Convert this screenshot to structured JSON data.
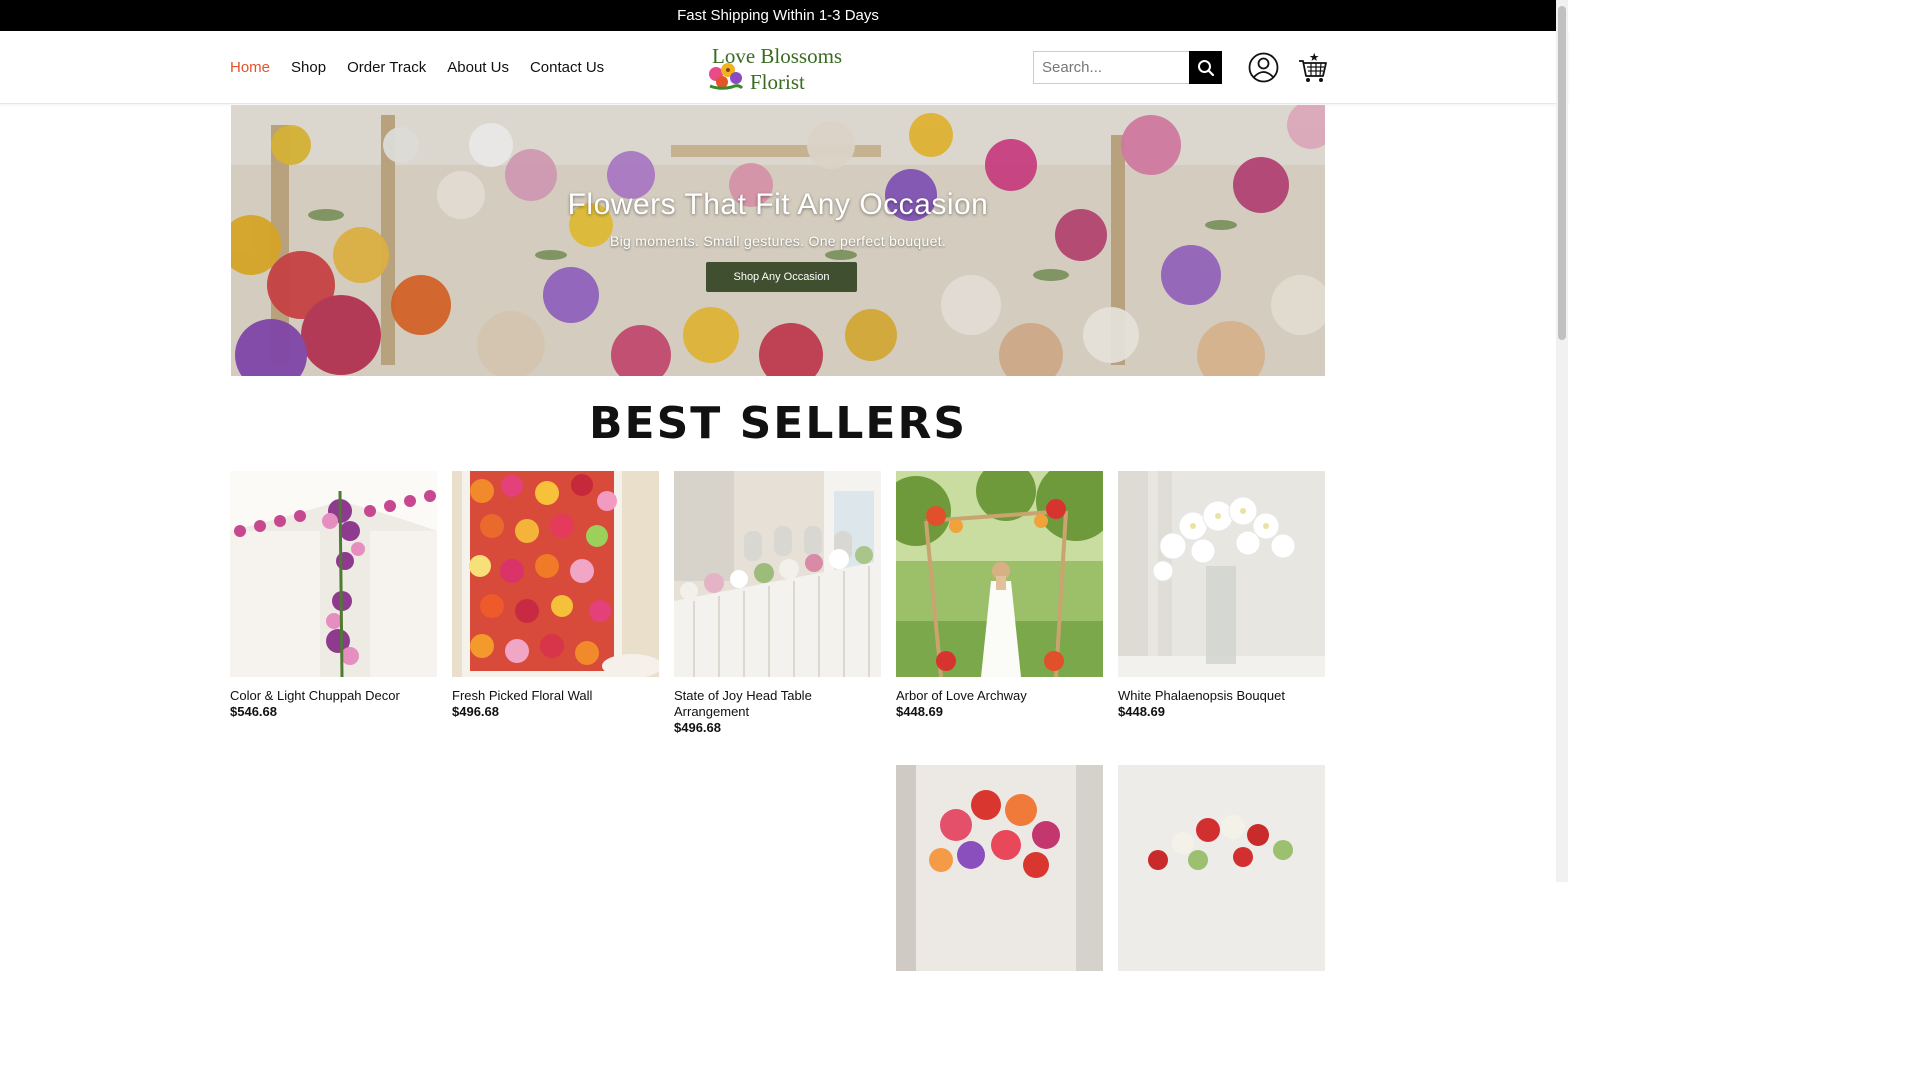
{
  "announcement": "Fast Shipping Within 1-3 Days",
  "nav": {
    "items": [
      {
        "label": "Home",
        "active": true
      },
      {
        "label": "Shop"
      },
      {
        "label": "Order Track"
      },
      {
        "label": "About Us"
      },
      {
        "label": "Contact Us"
      }
    ]
  },
  "logo": {
    "line1": "Love Blossoms",
    "line2": "Florist"
  },
  "search": {
    "placeholder": "Search..."
  },
  "icons": {
    "search": "search-icon",
    "account": "user-icon",
    "cart": "cart-icon"
  },
  "hero": {
    "title": "Flowers That Fit Any Occasion",
    "subtitle": "Big moments. Small gestures. One perfect bouquet.",
    "button": "Shop Any Occasion"
  },
  "section_title": "BEST SELLERS",
  "products": [
    {
      "name": "Color & Light Chuppah Decor",
      "price": "$546.68"
    },
    {
      "name": "Fresh Picked Floral Wall",
      "price": "$496.68"
    },
    {
      "name": "State of Joy Head Table Arrangement",
      "price": "$496.68"
    },
    {
      "name": "Arbor of Love Archway",
      "price": "$448.69"
    },
    {
      "name": "White Phalaenopsis Bouquet",
      "price": "$448.69"
    },
    {
      "name": "",
      "price": ""
    },
    {
      "name": "",
      "price": ""
    }
  ],
  "colors": {
    "accent": "#e5532b",
    "topbar": "#000000",
    "hero_button": "#3f4f30",
    "logo": "#3a6b22"
  }
}
